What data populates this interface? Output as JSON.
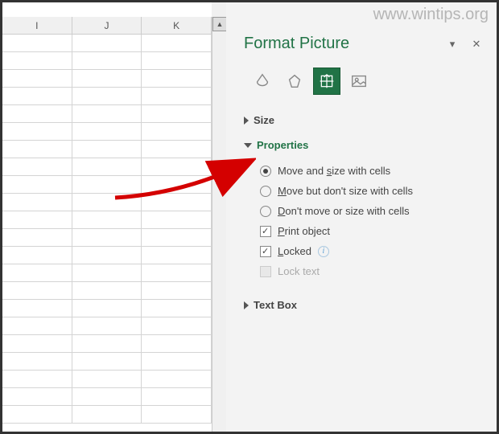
{
  "watermark": "www.wintips.org",
  "spreadsheet": {
    "columns": [
      "I",
      "J",
      "K"
    ]
  },
  "panel": {
    "title": "Format Picture",
    "sections": {
      "size": {
        "label": "Size"
      },
      "properties": {
        "label": "Properties",
        "options": {
          "moveSize": "Move and size with cells",
          "moveOnly": "Move but don't size with cells",
          "dontMove": "Don't move or size with cells",
          "print": "Print object",
          "locked": "Locked",
          "lockText": "Lock text"
        }
      },
      "textbox": {
        "label": "Text Box"
      }
    }
  }
}
